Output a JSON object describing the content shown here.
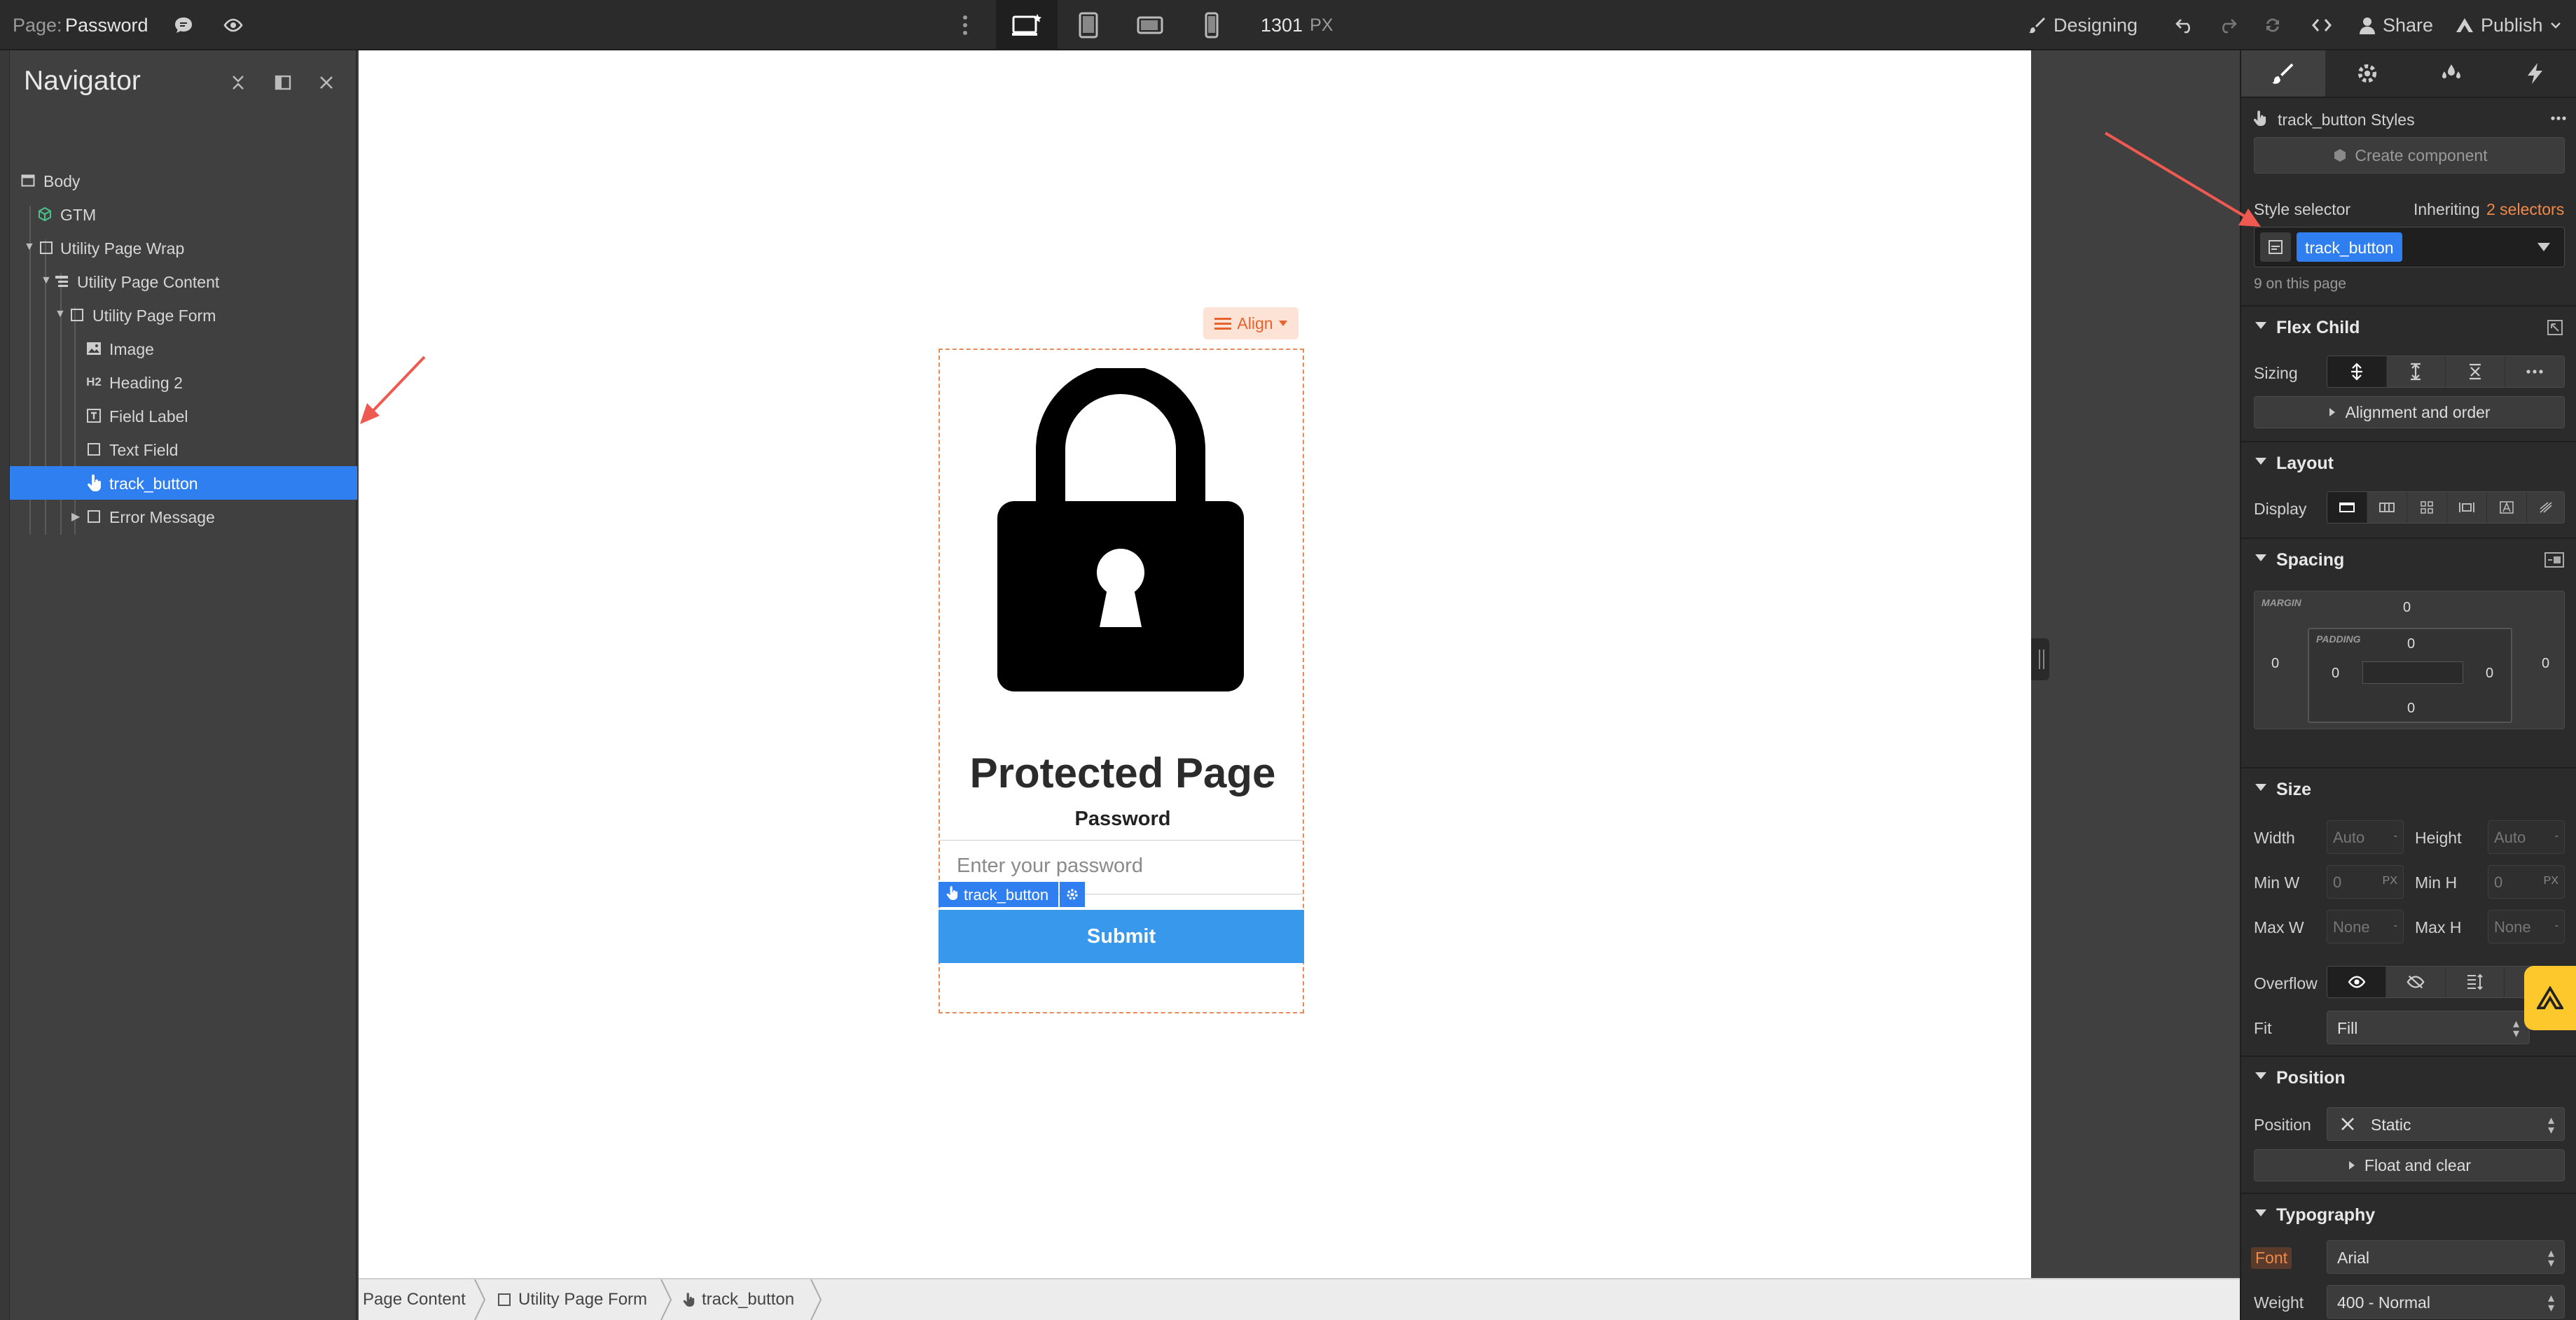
{
  "topbar": {
    "page_label": "Page:",
    "page_name": "Password",
    "canvas_width": "1301",
    "canvas_width_unit": "PX",
    "mode": "Designing",
    "share": "Share",
    "publish": "Publish",
    "breakpoints": [
      "desktop-star",
      "tablet",
      "mobile-landscape",
      "mobile-portrait"
    ],
    "active_breakpoint": "desktop-star"
  },
  "navigator": {
    "title": "Navigator",
    "items": [
      {
        "label": "Body",
        "icon": "body-icon"
      },
      {
        "label": "GTM",
        "icon": "component-icon"
      },
      {
        "label": "Utility Page Wrap",
        "icon": "div-block-icon"
      },
      {
        "label": "Utility Page Content",
        "icon": "form-icon"
      },
      {
        "label": "Utility Page Form",
        "icon": "div-block-icon"
      },
      {
        "label": "Image",
        "icon": "image-icon"
      },
      {
        "label": "Heading 2",
        "icon": "heading-icon"
      },
      {
        "label": "Field Label",
        "icon": "field-label-icon"
      },
      {
        "label": "Text Field",
        "icon": "text-field-icon"
      },
      {
        "label": "track_button",
        "icon": "button-hand-icon",
        "selected": true
      },
      {
        "label": "Error Message",
        "icon": "div-block-icon"
      }
    ],
    "heading_glyph": "H2"
  },
  "canvas": {
    "align_label": "Align",
    "heading": "Protected Page",
    "field_label": "Password",
    "input_placeholder": "Enter your password",
    "submit_label": "Submit",
    "selected_tag": "track_button"
  },
  "breadcrumbs": [
    "Page Content",
    "Utility Page Form",
    "track_button"
  ],
  "panel": {
    "element_title": "track_button Styles",
    "create_component": "Create component",
    "style_selector_label": "Style selector",
    "inheriting_prefix": "Inheriting",
    "inheriting_count": "2 selectors",
    "selector_chip": "track_button",
    "on_page": "9 on this page",
    "sections": {
      "flex_child": "Flex Child",
      "layout": "Layout",
      "spacing": "Spacing",
      "size": "Size",
      "position": "Position",
      "typography": "Typography"
    },
    "sizing_label": "Sizing",
    "alignment_order": "Alignment and order",
    "display_label": "Display",
    "spacing": {
      "margin_label": "MARGIN",
      "padding_label": "PADDING",
      "margin_top": "0",
      "margin_right": "0",
      "margin_bottom": "0",
      "margin_left": "0",
      "padding_top": "0",
      "padding_right": "0",
      "padding_bottom": "0",
      "padding_left": "0"
    },
    "size": {
      "width_label": "Width",
      "width_value": "Auto",
      "height_label": "Height",
      "height_value": "Auto",
      "minw_label": "Min W",
      "minw_value": "0",
      "minw_unit": "PX",
      "minh_label": "Min H",
      "minh_value": "0",
      "minh_unit": "PX",
      "maxw_label": "Max W",
      "maxw_value": "None",
      "maxh_label": "Max H",
      "maxh_value": "None",
      "dash": "-"
    },
    "overflow_label": "Overflow",
    "fit_label": "Fit",
    "fit_value": "Fill",
    "position_label": "Position",
    "position_value": "Static",
    "float_clear": "Float and clear",
    "font_label": "Font",
    "font_value": "Arial",
    "weight_label": "Weight",
    "weight_value": "400 - Normal"
  },
  "colors": {
    "accent_blue": "#2f7ff0",
    "submit_blue": "#3898ec",
    "warning_orange": "#e8622c",
    "annotation_red": "#ef5a50",
    "help_yellow": "#fcc82b"
  }
}
